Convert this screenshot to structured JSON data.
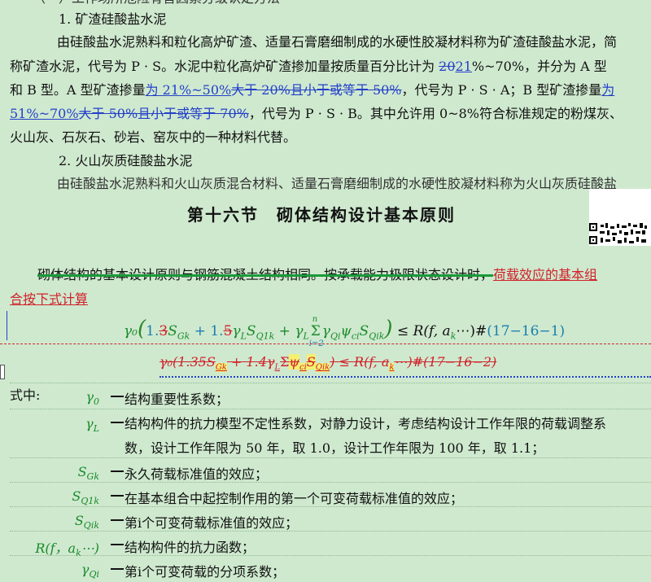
{
  "doc": {
    "top_cut": "（一）工作场所危险有害因素分级认定方法",
    "h1": "1. 矿渣硅酸盐水泥",
    "p1_a": "由硅酸盐水泥熟料和粒化高炉矿渣、适量石膏磨细制成的水硬性胶凝材料称为矿渣硅酸盐水泥，简",
    "p1_b1": "称矿渣水泥，代号为 P · S。水泥中粒化高炉矿渣掺加量按质量百分比计为 ",
    "p1_b2": "20",
    "p1_b3": "21",
    "p1_b4": "%~70%，并分为 A 型",
    "p1_c1": "和 B 型。A 型矿渣掺量",
    "p1_c2": "为 21%~50%",
    "p1_c3": "大于 20%且小于或等于 50%",
    "p1_c4": "，代号为 P · S · A；B 型矿渣掺量",
    "p1_c5": "为",
    "p1_d1": "51%~70%",
    "p1_d2": "大于 50%且小于或等于 70%",
    "p1_d3": "，代号为 P · S · B。其中允许用 0~8%符合标准规定的粉煤灰、",
    "p1_e": "火山灰、石灰石、砂岩、窑灰中的一种材料代替。",
    "h2": "2. 火山灰质硅酸盐水泥",
    "p2": "由硅酸盐水泥熟料和火山灰质混合材料、适量石膏磨细制成的水硬性胶凝材料称为火山灰质硅酸盐",
    "section_title": "第十六节　砌体结构设计基本原则",
    "intro_a": "砌体结构的基本设计原则与钢筋混凝土结构相同。按承载能力极限状态设计时，",
    "intro_b": "荷载效应的基本组",
    "intro_c": "合按下式计算",
    "eq1": {
      "gamma0": "γ₀",
      "open": "(",
      "c1a": "1.",
      "c1b": "3",
      "sgk": "S",
      "sgk_sub": "Gk",
      "plus1": " + 1.",
      "c2b": "5",
      "gl": "γ",
      "gl_sub": "L",
      "sq1": "S",
      "sq1_sub": "Q1k",
      "plus2": " + ",
      "gl2": "γ",
      "gl2_sub": "L",
      "sum_top": "n",
      "sum_bot": "i=2",
      "sigma": "Σ",
      "rest": "γ",
      "rest_sub1": "Qi",
      "psi": "ψ",
      "psi_sub": "ci",
      "sqi": "S",
      "sqi_sub": "Qik",
      "close": ")",
      "le": " ≤ ",
      "R": "R(f, a",
      "R_sub": "k",
      "R_end": "⋯)#",
      "num": "(17−16−1)"
    },
    "eq2": "γ₀(1.35S",
    "eq2_sub1": "Gk",
    "eq2_mid": " + 1.4γ",
    "eq2_sub2": "L",
    "eq2_sum": "Σ",
    "eq2_psi": "ψ",
    "eq2_psi_sub": "ci",
    "eq2_s": "S",
    "eq2_s_sub": "Qik",
    "eq2_end": ") ≤ R(f, a",
    "eq2_end_sub": "k",
    "eq2_end2": "⋯)#(17−16−2)",
    "where": "式中:",
    "terms": [
      {
        "sym": "γ",
        "sub": "0",
        "desc": "结构重要性系数；"
      },
      {
        "sym": "γ",
        "sub": "L",
        "desc": "结构构件的抗力模型不定性系数，对静力设计，考虑结构设计工作年限的荷载调整系"
      },
      {
        "sym": "",
        "sub": "",
        "desc": "数，设计工作年限为 50 年，取 1.0，设计工作年限为 100 年，取 1.1；"
      },
      {
        "sym": "S",
        "sub": "Gk",
        "desc": "永久荷载标准值的效应；"
      },
      {
        "sym": "S",
        "sub": "Q1k",
        "desc": "在基本组合中起控制作用的第一个可变荷载标准值的效应；"
      },
      {
        "sym": "S",
        "sub": "Qik",
        "desc": "第i个可变荷载标准值的效应；"
      },
      {
        "sym": "R(f，a",
        "sub": "k",
        "desc": "结构构件的抗力函数；",
        "tail": "⋯)"
      },
      {
        "sym": "γ",
        "sub": "Qi",
        "desc": "第i个可变荷载的分项系数；"
      }
    ]
  },
  "colors": {
    "page_bg": "#cfe9cf",
    "revision_blue": "#2340c8",
    "revision_red": "#d0222a",
    "math_green": "#1a8a2a",
    "highlight_yellow": "#f5f070"
  }
}
